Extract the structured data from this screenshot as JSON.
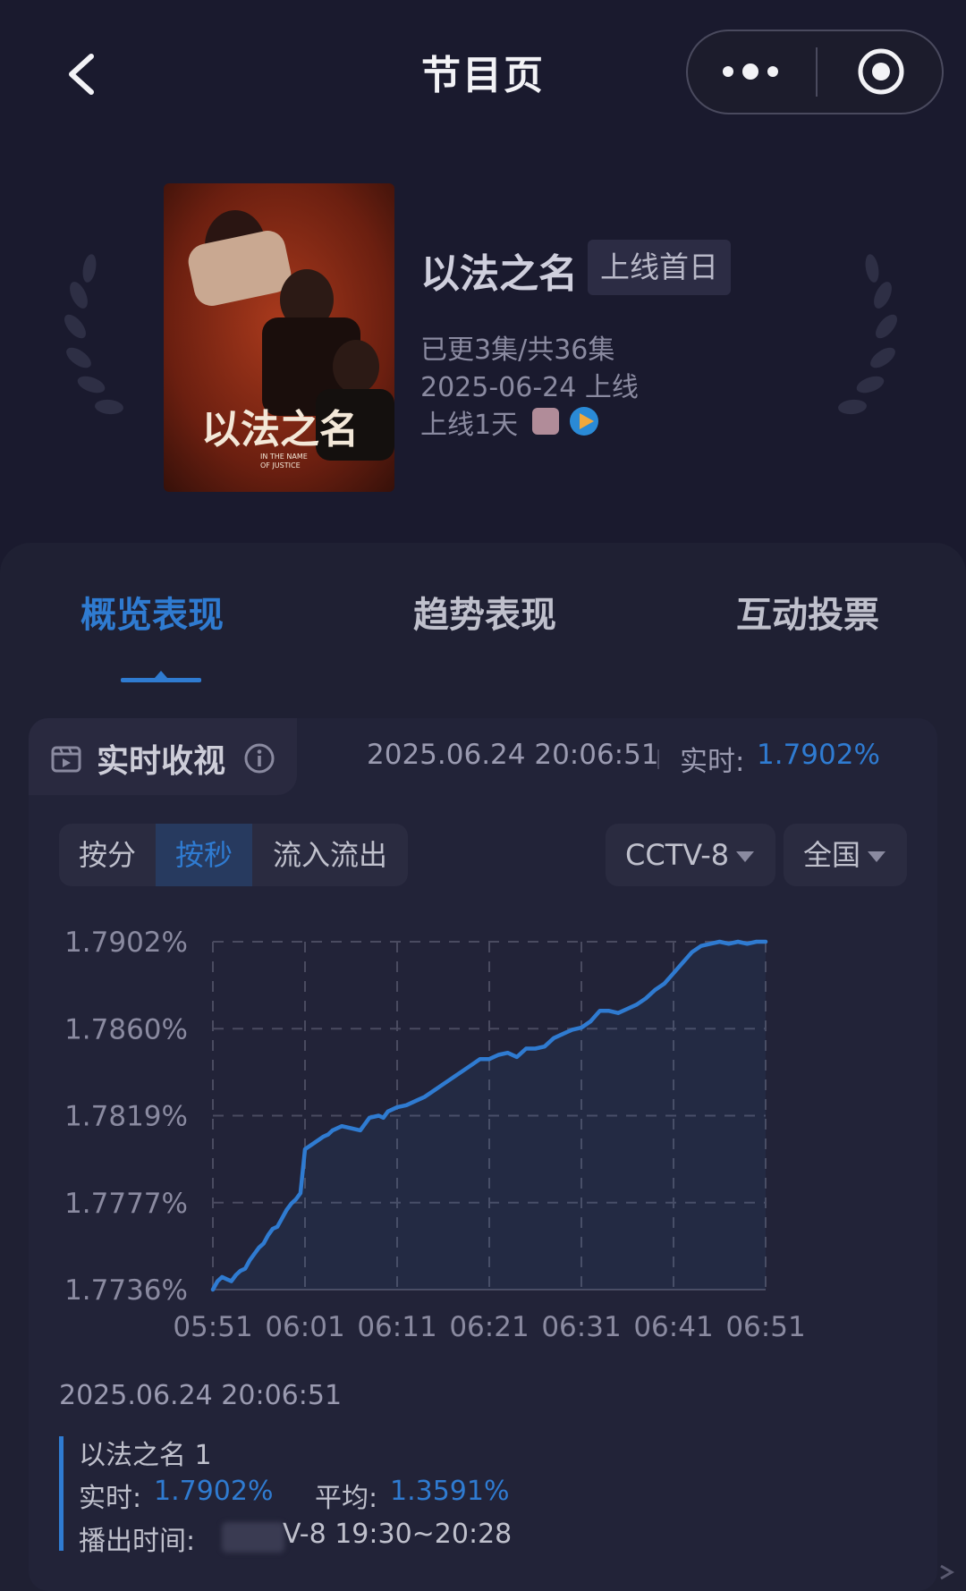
{
  "nav": {
    "title": "节目页",
    "back_icon": "chevron-left-icon",
    "more_icon": "more-dots-icon",
    "close_icon": "target-circle-icon"
  },
  "program": {
    "title": "以法之名",
    "status_tag": "上线首日",
    "episodes": "已更3集/共36集",
    "release": "2025-06-24 上线",
    "days_online": "上线1天",
    "poster_title": "以法之名",
    "poster_subtitle_1": "IN THE NAME",
    "poster_subtitle_2": "OF JUSTICE"
  },
  "tabs": [
    {
      "label": "概览表现",
      "active": true
    },
    {
      "label": "趋势表现",
      "active": false
    },
    {
      "label": "互动投票",
      "active": false
    }
  ],
  "card": {
    "title": "实时收视",
    "timestamp": "2025.06.24 20:06:51",
    "realtime_label": "实时:",
    "realtime_value": "1.7902%"
  },
  "segments": [
    {
      "label": "按分",
      "active": false
    },
    {
      "label": "按秒",
      "active": true
    },
    {
      "label": "流入流出",
      "active": false
    }
  ],
  "filters": {
    "channel": "CCTV-8",
    "region": "全国"
  },
  "chart_data": {
    "type": "line",
    "title": "",
    "xlabel": "",
    "ylabel": "",
    "x_ticks": [
      "05:51",
      "06:01",
      "06:11",
      "06:21",
      "06:31",
      "06:41",
      "06:51"
    ],
    "y_ticks": [
      "1.7736%",
      "1.7777%",
      "1.7819%",
      "1.7860%",
      "1.7902%"
    ],
    "ylim": [
      1.7736,
      1.7902
    ],
    "xlim_seconds": [
      0,
      60
    ],
    "grid": true,
    "series": [
      {
        "color": "#2f7bd1",
        "x": [
          0,
          0.5,
          1,
          1.5,
          2,
          2.5,
          3,
          3.5,
          4,
          4.5,
          5,
          5.5,
          6,
          6.5,
          7,
          7.5,
          8,
          8.5,
          9,
          9.5,
          10,
          11,
          12,
          12.5,
          13,
          14,
          15,
          16,
          17,
          18,
          18.5,
          19,
          20,
          21,
          22,
          23,
          24,
          25,
          26,
          27,
          28,
          29,
          30,
          31,
          32,
          33,
          34,
          35,
          36,
          37,
          38,
          39,
          40,
          41,
          42,
          43,
          44,
          45,
          46,
          47,
          48,
          49,
          50,
          51,
          52,
          53,
          54,
          55,
          56,
          57,
          58,
          59,
          60
        ],
        "values": [
          1.7736,
          1.774,
          1.7742,
          1.7741,
          1.774,
          1.7743,
          1.7745,
          1.7746,
          1.775,
          1.7753,
          1.7756,
          1.7758,
          1.7762,
          1.7765,
          1.7766,
          1.777,
          1.7774,
          1.7777,
          1.7779,
          1.7782,
          1.7803,
          1.7806,
          1.7809,
          1.781,
          1.7812,
          1.7814,
          1.7813,
          1.7812,
          1.7818,
          1.7819,
          1.7818,
          1.7821,
          1.7823,
          1.7824,
          1.7826,
          1.7828,
          1.7831,
          1.7834,
          1.7837,
          1.784,
          1.7843,
          1.7846,
          1.7846,
          1.7848,
          1.7849,
          1.7847,
          1.7851,
          1.7851,
          1.7852,
          1.7856,
          1.7858,
          1.786,
          1.7861,
          1.7864,
          1.7869,
          1.7869,
          1.7868,
          1.787,
          1.7872,
          1.7875,
          1.7879,
          1.7882,
          1.7887,
          1.7892,
          1.7897,
          1.79,
          1.7901,
          1.7902,
          1.7901,
          1.7902,
          1.7901,
          1.7902,
          1.7902
        ]
      }
    ]
  },
  "detail": {
    "timestamp": "2025.06.24 20:06:51",
    "program_name": "以法之名 1",
    "realtime_label": "实时:",
    "realtime_value": "1.7902%",
    "average_label": "平均:",
    "average_value": "1.3591%",
    "airtime_label": "播出时间:",
    "airtime_value": "V-8 19:30~20:28"
  }
}
